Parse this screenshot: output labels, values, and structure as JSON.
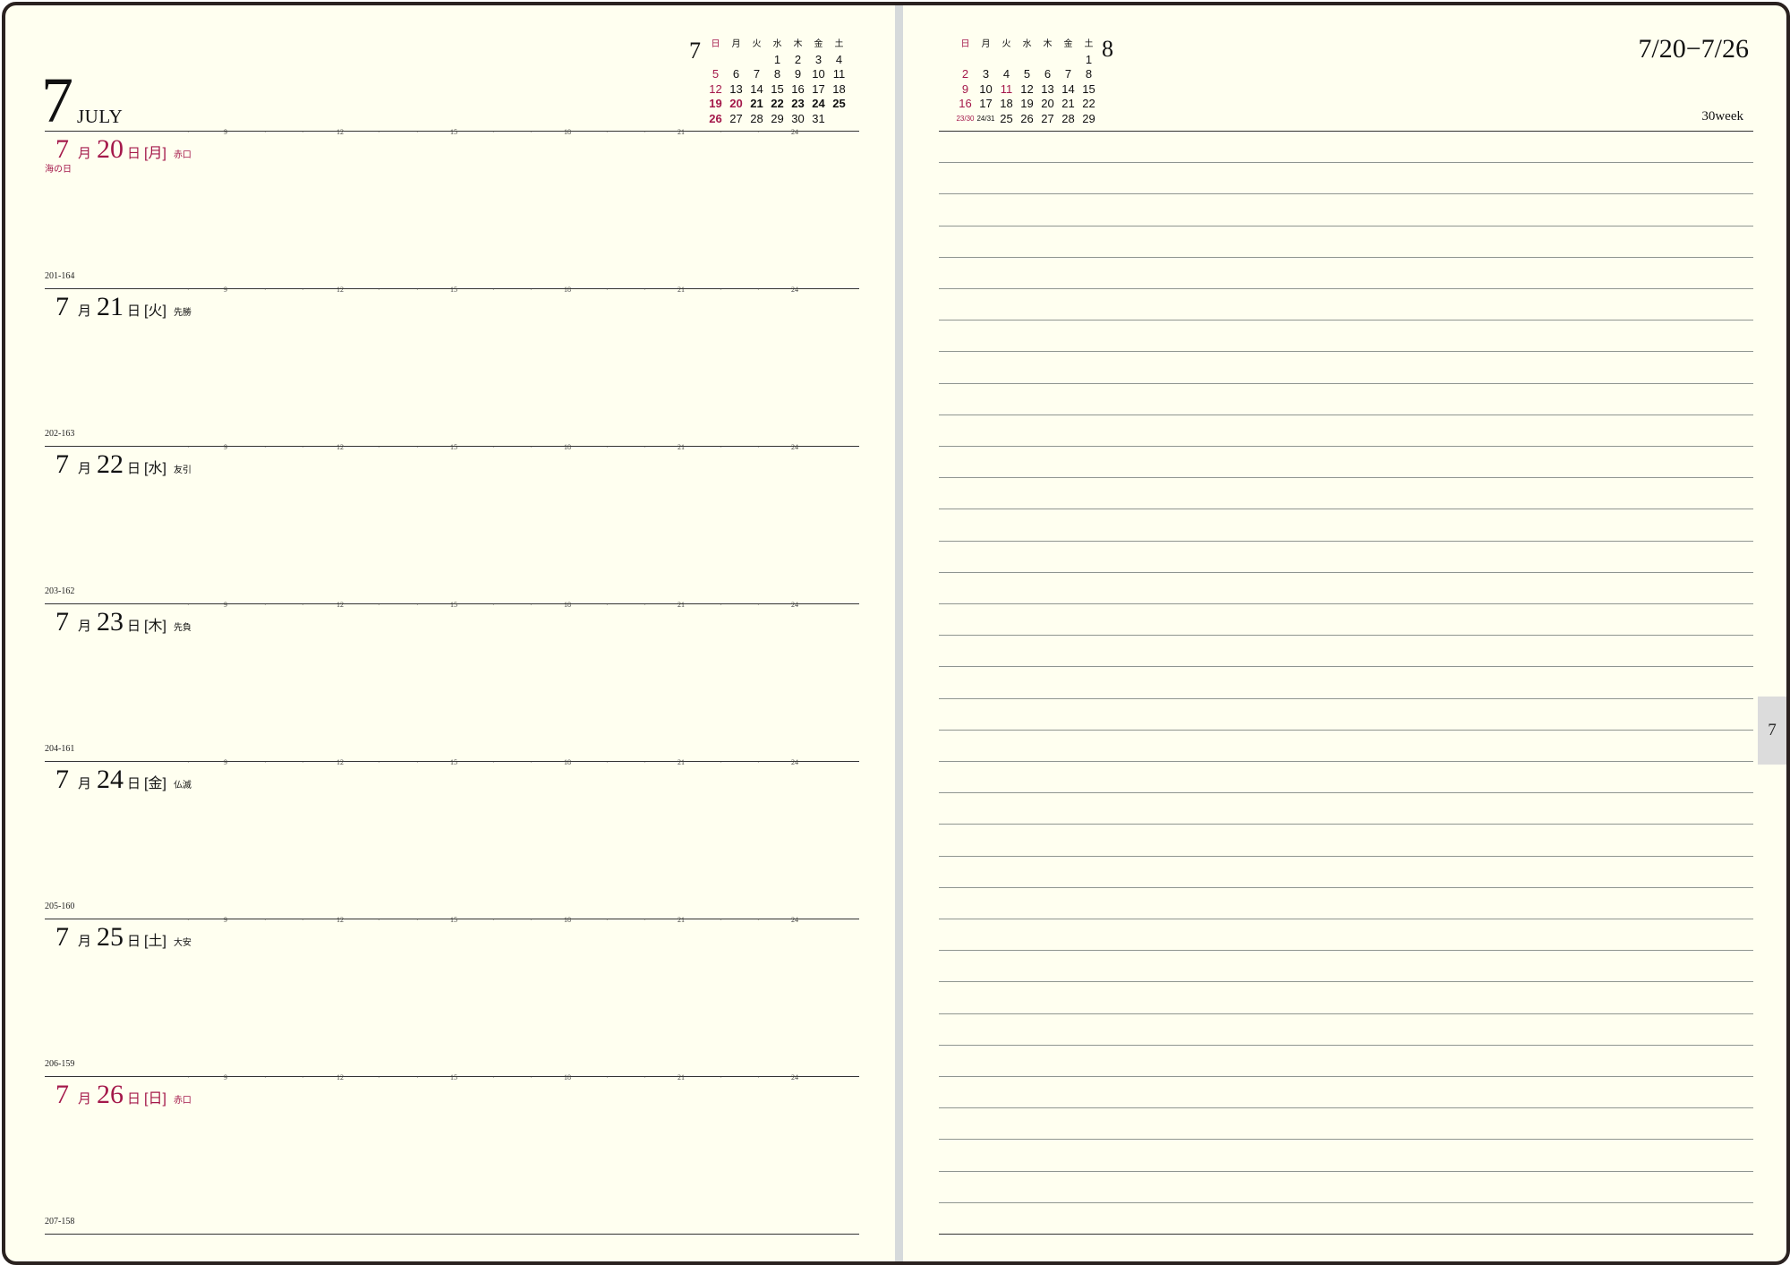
{
  "month": {
    "number": "7",
    "name": "JULY"
  },
  "week": {
    "range": "7/20−7/26",
    "label": "30week"
  },
  "tab": {
    "label": "7"
  },
  "calendar_july": {
    "month": "7",
    "weekdays": [
      "日",
      "月",
      "火",
      "水",
      "木",
      "金",
      "土"
    ],
    "rows": [
      [
        "",
        "",
        "",
        "1",
        "2",
        "3",
        "4"
      ],
      [
        "5",
        "6",
        "7",
        "8",
        "9",
        "10",
        "11"
      ],
      [
        "12",
        "13",
        "14",
        "15",
        "16",
        "17",
        "18"
      ],
      [
        "19",
        "20",
        "21",
        "22",
        "23",
        "24",
        "25"
      ],
      [
        "26",
        "27",
        "28",
        "29",
        "30",
        "31",
        ""
      ]
    ]
  },
  "calendar_august": {
    "month": "8",
    "weekdays": [
      "日",
      "月",
      "火",
      "水",
      "木",
      "金",
      "土"
    ],
    "rows": [
      [
        "",
        "",
        "",
        "",
        "",
        "",
        "1"
      ],
      [
        "2",
        "3",
        "4",
        "5",
        "6",
        "7",
        "8"
      ],
      [
        "9",
        "10",
        "11",
        "12",
        "13",
        "14",
        "15"
      ],
      [
        "16",
        "17",
        "18",
        "19",
        "20",
        "21",
        "22"
      ],
      [
        "23/30",
        "24/31",
        "25",
        "26",
        "27",
        "28",
        "29"
      ]
    ]
  },
  "hour_marks": [
    "9",
    "12",
    "15",
    "18",
    "21",
    "24"
  ],
  "days": [
    {
      "month": "7",
      "month_kanji": "月",
      "day": "20",
      "day_kanji": "日",
      "weekday": "[月]",
      "rokuyo": "赤口",
      "holiday": "海の日",
      "counter": "201-164"
    },
    {
      "month": "7",
      "month_kanji": "月",
      "day": "21",
      "day_kanji": "日",
      "weekday": "[火]",
      "rokuyo": "先勝",
      "holiday": "",
      "counter": "202-163"
    },
    {
      "month": "7",
      "month_kanji": "月",
      "day": "22",
      "day_kanji": "日",
      "weekday": "[水]",
      "rokuyo": "友引",
      "holiday": "",
      "counter": "203-162"
    },
    {
      "month": "7",
      "month_kanji": "月",
      "day": "23",
      "day_kanji": "日",
      "weekday": "[木]",
      "rokuyo": "先負",
      "holiday": "",
      "counter": "204-161"
    },
    {
      "month": "7",
      "month_kanji": "月",
      "day": "24",
      "day_kanji": "日",
      "weekday": "[金]",
      "rokuyo": "仏滅",
      "holiday": "",
      "counter": "205-160"
    },
    {
      "month": "7",
      "month_kanji": "月",
      "day": "25",
      "day_kanji": "日",
      "weekday": "[土]",
      "rokuyo": "大安",
      "holiday": "",
      "counter": "206-159"
    },
    {
      "month": "7",
      "month_kanji": "月",
      "day": "26",
      "day_kanji": "日",
      "weekday": "[日]",
      "rokuyo": "赤口",
      "holiday": "",
      "counter": "207-158"
    }
  ]
}
